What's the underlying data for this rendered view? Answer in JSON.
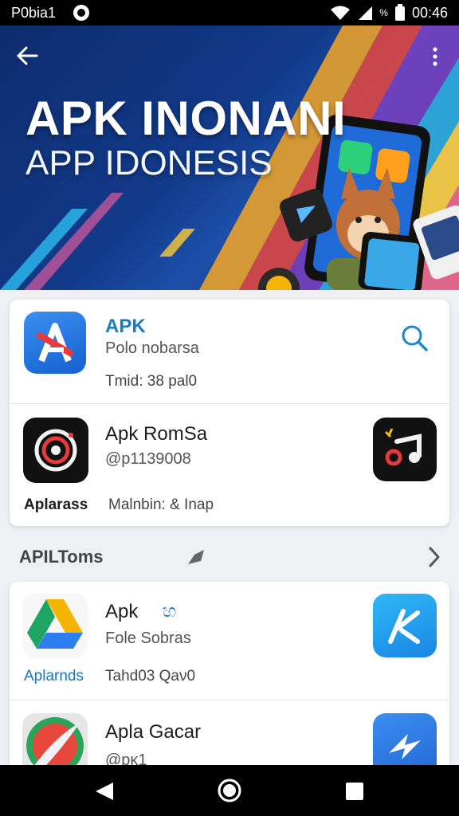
{
  "status_bar": {
    "carrier": "P0bia1",
    "time": "00:46",
    "battery_label": "%"
  },
  "hero": {
    "title": "APK INONANI",
    "subtitle": "APP IDONESIS"
  },
  "featured": {
    "items": [
      {
        "name": "APK",
        "subtitle": "Polo nobarsa",
        "meta": "Tmid: 38 pal0",
        "accent": "#1a7bbf"
      },
      {
        "name": "Apk RomSa",
        "subtitle": "@p1139008",
        "tag": "Aplarass",
        "meta": "Malnbin: & Inap"
      }
    ]
  },
  "section": {
    "title": "APILToms",
    "items": [
      {
        "name": "Apk",
        "badge": "හ",
        "subtitle": "Fole Sobras",
        "tag": "Aplarnds",
        "meta": "Tahd03 Qaν0"
      },
      {
        "name": "Apla Gacar",
        "subtitle": "@pκ1"
      }
    ]
  },
  "colors": {
    "accent_blue": "#1a7bbf",
    "tag_blue": "#1677c8"
  }
}
